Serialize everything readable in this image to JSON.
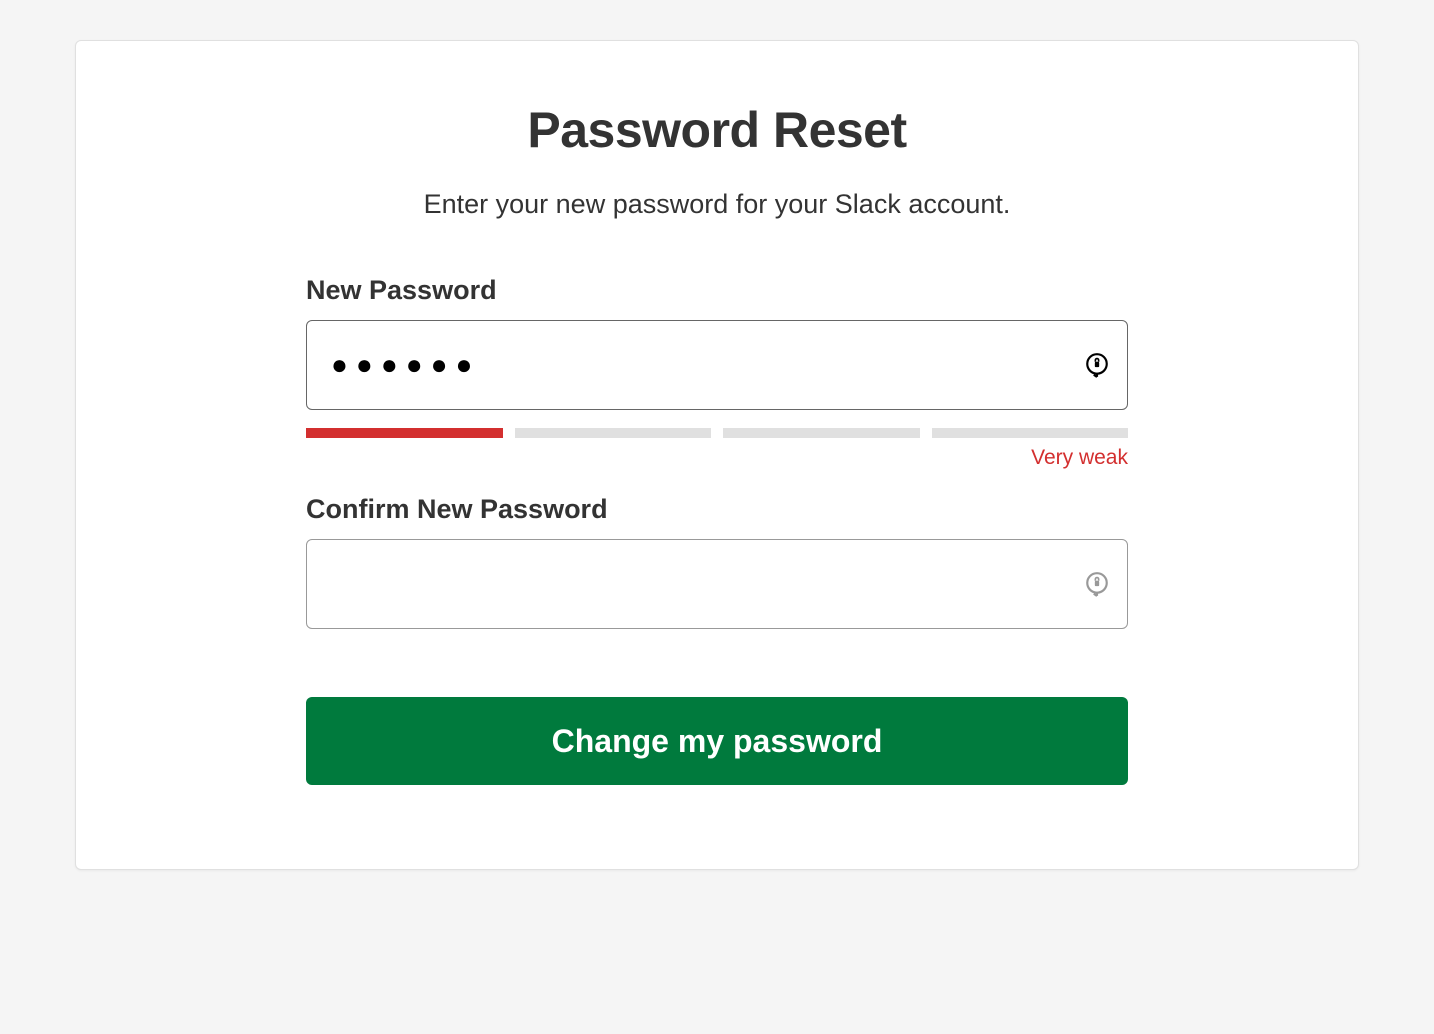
{
  "page": {
    "title": "Password Reset",
    "subtitle": "Enter your new password for your  Slack account."
  },
  "form": {
    "new_password": {
      "label": "New Password",
      "value": "●●●●●●"
    },
    "confirm_password": {
      "label": "Confirm New Password",
      "value": ""
    },
    "strength": {
      "label": "Very weak",
      "level": 1,
      "total_segments": 4,
      "color": "#d32f2f"
    },
    "submit_label": "Change my password"
  }
}
